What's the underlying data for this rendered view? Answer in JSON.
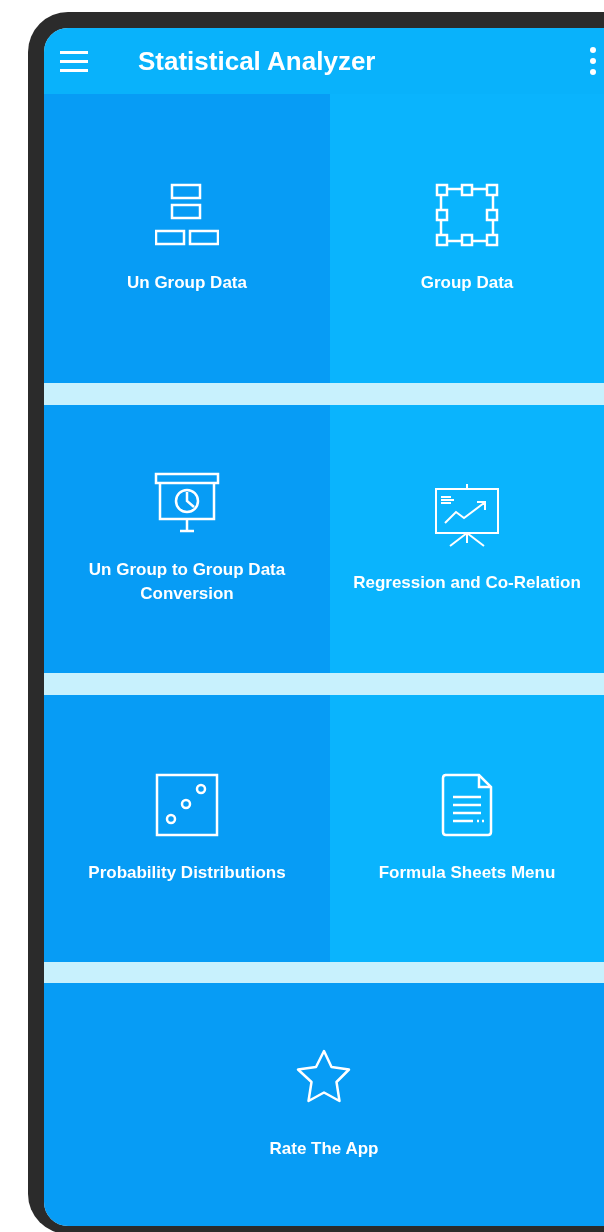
{
  "app_bar": {
    "title": "Statistical Analyzer"
  },
  "tiles": [
    {
      "label": "Un Group Data",
      "kind": "blocks"
    },
    {
      "label": "Group Data",
      "kind": "selection"
    },
    {
      "label": "Un Group to Group Data Conversion",
      "kind": "projector"
    },
    {
      "label": "Regression and Co-Relation",
      "kind": "trend"
    },
    {
      "label": "Probability Distributions",
      "kind": "dice"
    },
    {
      "label": "Formula Sheets Menu",
      "kind": "document"
    }
  ],
  "footer_tile": {
    "label": "Rate The App",
    "kind": "star"
  }
}
